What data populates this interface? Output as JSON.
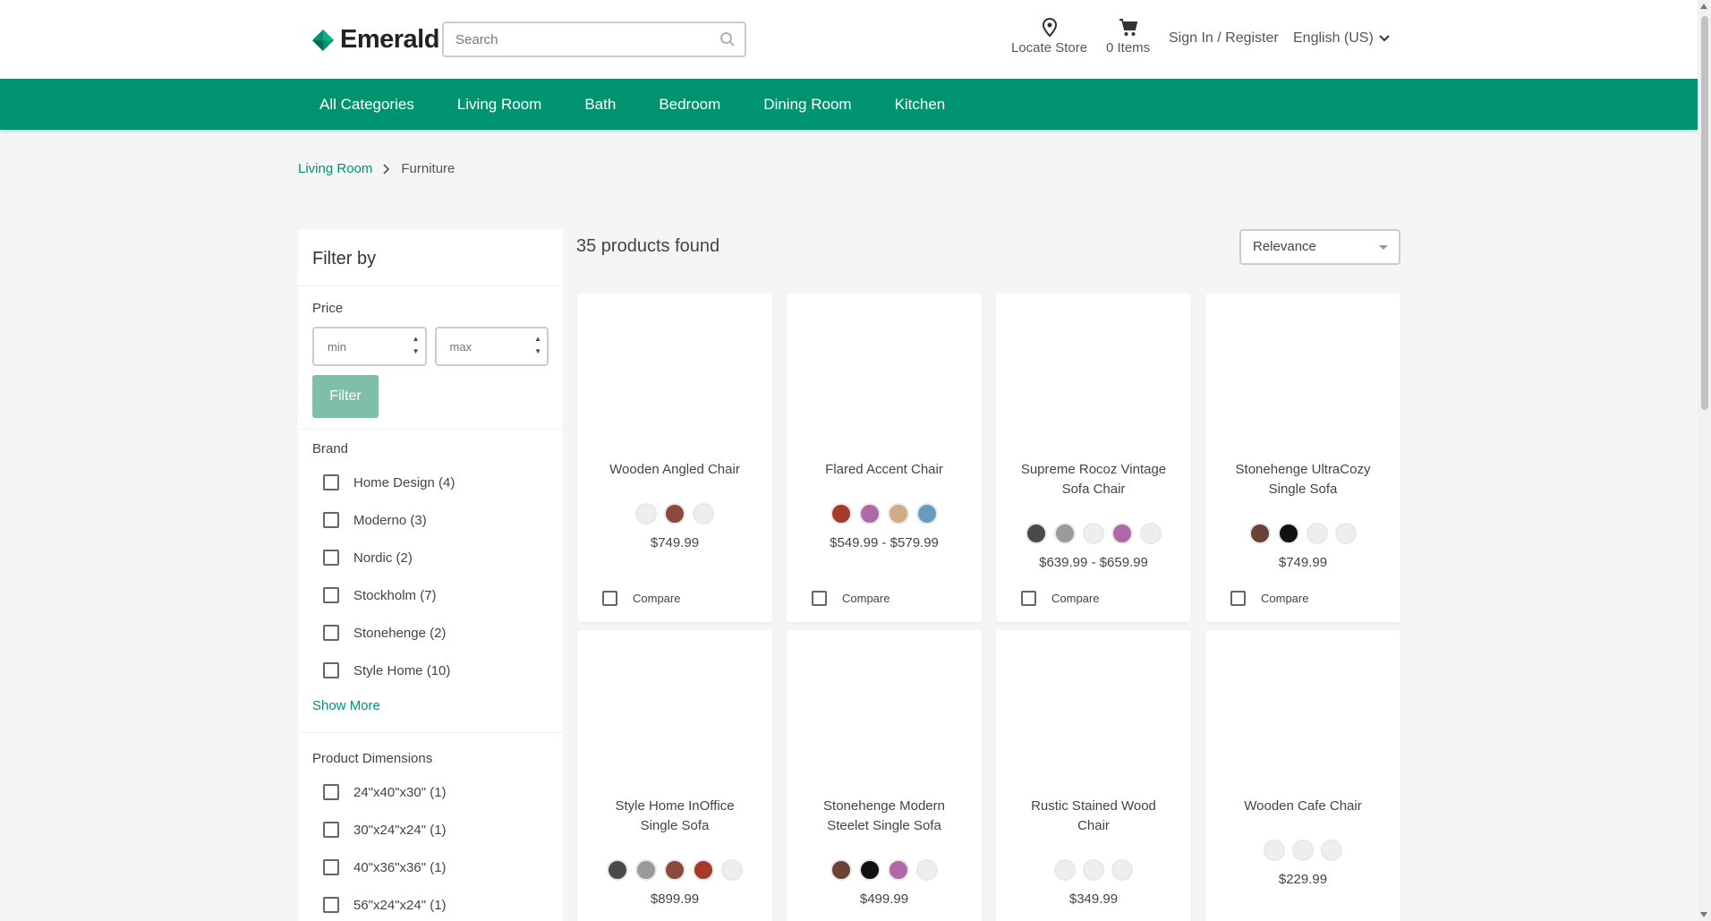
{
  "header": {
    "brand": "Emerald",
    "search_placeholder": "Search",
    "locate_store": "Locate Store",
    "cart_items": "0 Items",
    "sign_in": "Sign In / Register",
    "language": "English (US)"
  },
  "nav": [
    "All Categories",
    "Living Room",
    "Bath",
    "Bedroom",
    "Dining Room",
    "Kitchen"
  ],
  "breadcrumb": {
    "parent": "Living Room",
    "current": "Furniture"
  },
  "filter": {
    "title": "Filter by",
    "price_label": "Price",
    "min_placeholder": "min",
    "max_placeholder": "max",
    "filter_button": "Filter",
    "brand_label": "Brand",
    "brands": [
      "Home Design (4)",
      "Moderno (3)",
      "Nordic (2)",
      "Stockholm (7)",
      "Stonehenge (2)",
      "Style Home (10)"
    ],
    "show_more": "Show More",
    "dimensions_label": "Product Dimensions",
    "dimensions": [
      "24\"x40\"x30\" (1)",
      "30\"x24\"x24\" (1)",
      "40\"x36\"x36\" (1)",
      "56\"x24\"x24\" (1)"
    ]
  },
  "results": {
    "count_text": "35 products found",
    "sort_selected": "Relevance",
    "compare_label": "Compare"
  },
  "products": [
    {
      "name": "Wooden Angled Chair",
      "price": "$749.99",
      "colors": [
        "#eeeeee",
        "#8b4a3c",
        "#eeeeee"
      ]
    },
    {
      "name": "Flared Accent Chair",
      "price": "$549.99 - $579.99",
      "colors": [
        "#a33a2a",
        "#b069a8",
        "#cfac84",
        "#6a9cc0"
      ]
    },
    {
      "name": "Supreme Rocoz Vintage Sofa Chair",
      "price": "$639.99 - $659.99",
      "colors": [
        "#4a4a4a",
        "#9a9a9a",
        "#eeeeee",
        "#b069a8",
        "#eeeeee"
      ]
    },
    {
      "name": "Stonehenge UltraCozy Single Sofa",
      "price": "$749.99",
      "colors": [
        "#6b4236",
        "#111111",
        "#eeeeee",
        "#eeeeee"
      ]
    },
    {
      "name": "Style Home InOffice Single Sofa",
      "price": "$899.99",
      "colors": [
        "#4a4a4a",
        "#9a9a9a",
        "#8b4a3c",
        "#a33a2a",
        "#eeeeee"
      ]
    },
    {
      "name": "Stonehenge Modern Steelet Single Sofa",
      "price": "$499.99",
      "colors": [
        "#6b4236",
        "#111111",
        "#b069a8",
        "#eeeeee"
      ]
    },
    {
      "name": "Rustic Stained Wood Chair",
      "price": "$349.99",
      "colors": [
        "#eeeeee",
        "#eeeeee",
        "#eeeeee"
      ]
    },
    {
      "name": "Wooden Cafe Chair",
      "price": "$229.99",
      "colors": [
        "#eeeeee",
        "#eeeeee",
        "#eeeeee"
      ]
    }
  ],
  "colors": {
    "accent": "#009370",
    "filter_button": "#7fbfa7"
  }
}
